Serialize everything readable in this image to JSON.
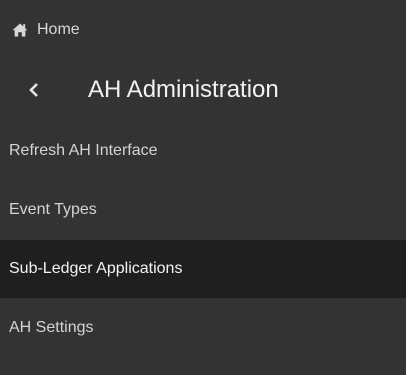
{
  "home": {
    "label": "Home",
    "icon": "home-icon"
  },
  "section": {
    "title": "AH Administration",
    "back_icon": "chevron-left-icon"
  },
  "nav": {
    "items": [
      {
        "label": "Refresh AH Interface",
        "selected": false
      },
      {
        "label": "Event Types",
        "selected": false
      },
      {
        "label": "Sub-Ledger Applications",
        "selected": true
      },
      {
        "label": "AH Settings",
        "selected": false
      }
    ]
  },
  "colors": {
    "panel_bg": "#333333",
    "selected_bg": "#1f1f1f",
    "text": "#d4d4d4"
  }
}
